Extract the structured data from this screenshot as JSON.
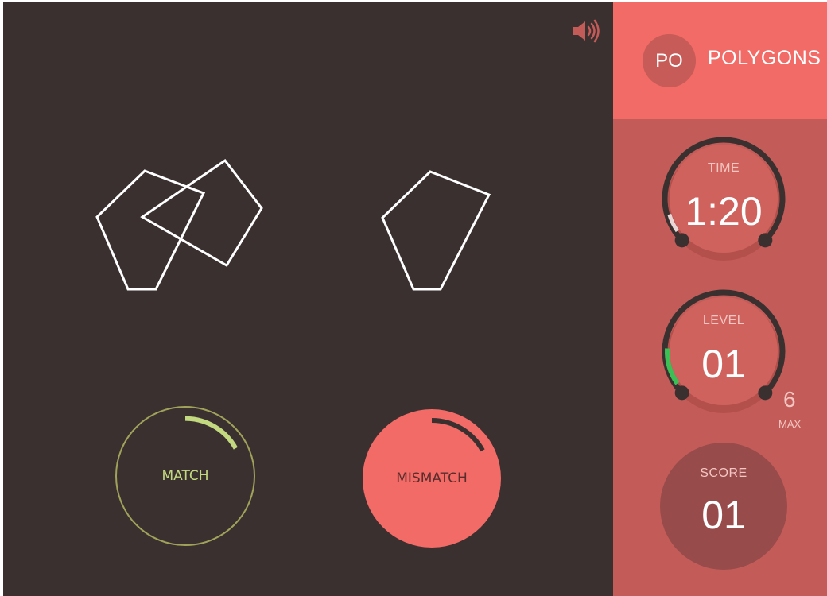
{
  "game": {
    "badge": "PO",
    "title": "POLYGONS"
  },
  "controls": {
    "sound_icon": "speaker-volume-icon",
    "match_label": "MATCH",
    "mismatch_label": "MISMATCH",
    "match_timer_fraction": 0.17,
    "mismatch_timer_fraction": 0.17
  },
  "stats": {
    "time": {
      "label": "TIME",
      "value": "1:20",
      "progress_fraction": 0.07
    },
    "level": {
      "label": "LEVEL",
      "value": "01",
      "max_value": "6",
      "max_label": "MAX",
      "progress_fraction": 0.14
    },
    "score": {
      "label": "SCORE",
      "value": "01"
    }
  },
  "colors": {
    "play_background": "#3b3030",
    "sidebar": "#c35c58",
    "header": "#f26b66",
    "accent": "#f26b66",
    "match_green": "#c3d97f",
    "level_progress": "#3dbf55",
    "time_progress": "#e8d7d5",
    "shape_outline": "#ffffff"
  }
}
